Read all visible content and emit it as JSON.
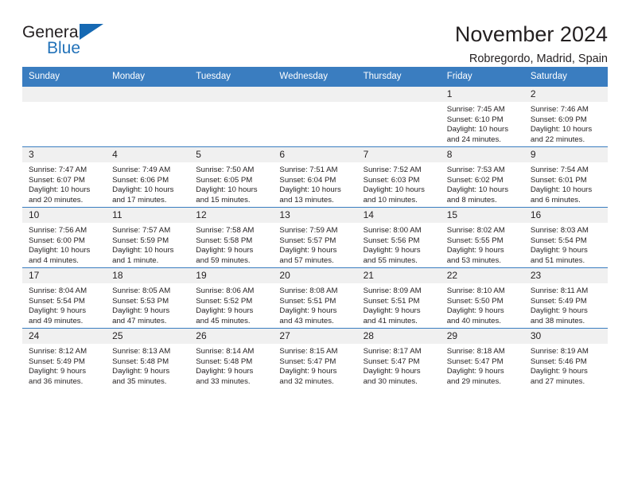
{
  "logo": {
    "word_one": "General",
    "word_two": "Blue",
    "triangle_icon": "blue-triangle-icon",
    "accent_color": "#1669b3"
  },
  "header": {
    "title": "November 2024",
    "location": "Robregordo, Madrid, Spain"
  },
  "theme": {
    "header_row_color": "#3a7dc0",
    "daynum_band_color": "#f0f0f0",
    "text_color": "#231f20"
  },
  "calendar": {
    "weekday_headers": [
      "Sunday",
      "Monday",
      "Tuesday",
      "Wednesday",
      "Thursday",
      "Friday",
      "Saturday"
    ],
    "weeks": [
      [
        {
          "day": "",
          "empty": true
        },
        {
          "day": "",
          "empty": true
        },
        {
          "day": "",
          "empty": true
        },
        {
          "day": "",
          "empty": true
        },
        {
          "day": "",
          "empty": true
        },
        {
          "day": "1",
          "sunrise": "Sunrise: 7:45 AM",
          "sunset": "Sunset: 6:10 PM",
          "daylight_line1": "Daylight: 10 hours",
          "daylight_line2": "and 24 minutes."
        },
        {
          "day": "2",
          "sunrise": "Sunrise: 7:46 AM",
          "sunset": "Sunset: 6:09 PM",
          "daylight_line1": "Daylight: 10 hours",
          "daylight_line2": "and 22 minutes."
        }
      ],
      [
        {
          "day": "3",
          "sunrise": "Sunrise: 7:47 AM",
          "sunset": "Sunset: 6:07 PM",
          "daylight_line1": "Daylight: 10 hours",
          "daylight_line2": "and 20 minutes."
        },
        {
          "day": "4",
          "sunrise": "Sunrise: 7:49 AM",
          "sunset": "Sunset: 6:06 PM",
          "daylight_line1": "Daylight: 10 hours",
          "daylight_line2": "and 17 minutes."
        },
        {
          "day": "5",
          "sunrise": "Sunrise: 7:50 AM",
          "sunset": "Sunset: 6:05 PM",
          "daylight_line1": "Daylight: 10 hours",
          "daylight_line2": "and 15 minutes."
        },
        {
          "day": "6",
          "sunrise": "Sunrise: 7:51 AM",
          "sunset": "Sunset: 6:04 PM",
          "daylight_line1": "Daylight: 10 hours",
          "daylight_line2": "and 13 minutes."
        },
        {
          "day": "7",
          "sunrise": "Sunrise: 7:52 AM",
          "sunset": "Sunset: 6:03 PM",
          "daylight_line1": "Daylight: 10 hours",
          "daylight_line2": "and 10 minutes."
        },
        {
          "day": "8",
          "sunrise": "Sunrise: 7:53 AM",
          "sunset": "Sunset: 6:02 PM",
          "daylight_line1": "Daylight: 10 hours",
          "daylight_line2": "and 8 minutes."
        },
        {
          "day": "9",
          "sunrise": "Sunrise: 7:54 AM",
          "sunset": "Sunset: 6:01 PM",
          "daylight_line1": "Daylight: 10 hours",
          "daylight_line2": "and 6 minutes."
        }
      ],
      [
        {
          "day": "10",
          "sunrise": "Sunrise: 7:56 AM",
          "sunset": "Sunset: 6:00 PM",
          "daylight_line1": "Daylight: 10 hours",
          "daylight_line2": "and 4 minutes."
        },
        {
          "day": "11",
          "sunrise": "Sunrise: 7:57 AM",
          "sunset": "Sunset: 5:59 PM",
          "daylight_line1": "Daylight: 10 hours",
          "daylight_line2": "and 1 minute."
        },
        {
          "day": "12",
          "sunrise": "Sunrise: 7:58 AM",
          "sunset": "Sunset: 5:58 PM",
          "daylight_line1": "Daylight: 9 hours",
          "daylight_line2": "and 59 minutes."
        },
        {
          "day": "13",
          "sunrise": "Sunrise: 7:59 AM",
          "sunset": "Sunset: 5:57 PM",
          "daylight_line1": "Daylight: 9 hours",
          "daylight_line2": "and 57 minutes."
        },
        {
          "day": "14",
          "sunrise": "Sunrise: 8:00 AM",
          "sunset": "Sunset: 5:56 PM",
          "daylight_line1": "Daylight: 9 hours",
          "daylight_line2": "and 55 minutes."
        },
        {
          "day": "15",
          "sunrise": "Sunrise: 8:02 AM",
          "sunset": "Sunset: 5:55 PM",
          "daylight_line1": "Daylight: 9 hours",
          "daylight_line2": "and 53 minutes."
        },
        {
          "day": "16",
          "sunrise": "Sunrise: 8:03 AM",
          "sunset": "Sunset: 5:54 PM",
          "daylight_line1": "Daylight: 9 hours",
          "daylight_line2": "and 51 minutes."
        }
      ],
      [
        {
          "day": "17",
          "sunrise": "Sunrise: 8:04 AM",
          "sunset": "Sunset: 5:54 PM",
          "daylight_line1": "Daylight: 9 hours",
          "daylight_line2": "and 49 minutes."
        },
        {
          "day": "18",
          "sunrise": "Sunrise: 8:05 AM",
          "sunset": "Sunset: 5:53 PM",
          "daylight_line1": "Daylight: 9 hours",
          "daylight_line2": "and 47 minutes."
        },
        {
          "day": "19",
          "sunrise": "Sunrise: 8:06 AM",
          "sunset": "Sunset: 5:52 PM",
          "daylight_line1": "Daylight: 9 hours",
          "daylight_line2": "and 45 minutes."
        },
        {
          "day": "20",
          "sunrise": "Sunrise: 8:08 AM",
          "sunset": "Sunset: 5:51 PM",
          "daylight_line1": "Daylight: 9 hours",
          "daylight_line2": "and 43 minutes."
        },
        {
          "day": "21",
          "sunrise": "Sunrise: 8:09 AM",
          "sunset": "Sunset: 5:51 PM",
          "daylight_line1": "Daylight: 9 hours",
          "daylight_line2": "and 41 minutes."
        },
        {
          "day": "22",
          "sunrise": "Sunrise: 8:10 AM",
          "sunset": "Sunset: 5:50 PM",
          "daylight_line1": "Daylight: 9 hours",
          "daylight_line2": "and 40 minutes."
        },
        {
          "day": "23",
          "sunrise": "Sunrise: 8:11 AM",
          "sunset": "Sunset: 5:49 PM",
          "daylight_line1": "Daylight: 9 hours",
          "daylight_line2": "and 38 minutes."
        }
      ],
      [
        {
          "day": "24",
          "sunrise": "Sunrise: 8:12 AM",
          "sunset": "Sunset: 5:49 PM",
          "daylight_line1": "Daylight: 9 hours",
          "daylight_line2": "and 36 minutes."
        },
        {
          "day": "25",
          "sunrise": "Sunrise: 8:13 AM",
          "sunset": "Sunset: 5:48 PM",
          "daylight_line1": "Daylight: 9 hours",
          "daylight_line2": "and 35 minutes."
        },
        {
          "day": "26",
          "sunrise": "Sunrise: 8:14 AM",
          "sunset": "Sunset: 5:48 PM",
          "daylight_line1": "Daylight: 9 hours",
          "daylight_line2": "and 33 minutes."
        },
        {
          "day": "27",
          "sunrise": "Sunrise: 8:15 AM",
          "sunset": "Sunset: 5:47 PM",
          "daylight_line1": "Daylight: 9 hours",
          "daylight_line2": "and 32 minutes."
        },
        {
          "day": "28",
          "sunrise": "Sunrise: 8:17 AM",
          "sunset": "Sunset: 5:47 PM",
          "daylight_line1": "Daylight: 9 hours",
          "daylight_line2": "and 30 minutes."
        },
        {
          "day": "29",
          "sunrise": "Sunrise: 8:18 AM",
          "sunset": "Sunset: 5:47 PM",
          "daylight_line1": "Daylight: 9 hours",
          "daylight_line2": "and 29 minutes."
        },
        {
          "day": "30",
          "sunrise": "Sunrise: 8:19 AM",
          "sunset": "Sunset: 5:46 PM",
          "daylight_line1": "Daylight: 9 hours",
          "daylight_line2": "and 27 minutes."
        }
      ]
    ]
  }
}
